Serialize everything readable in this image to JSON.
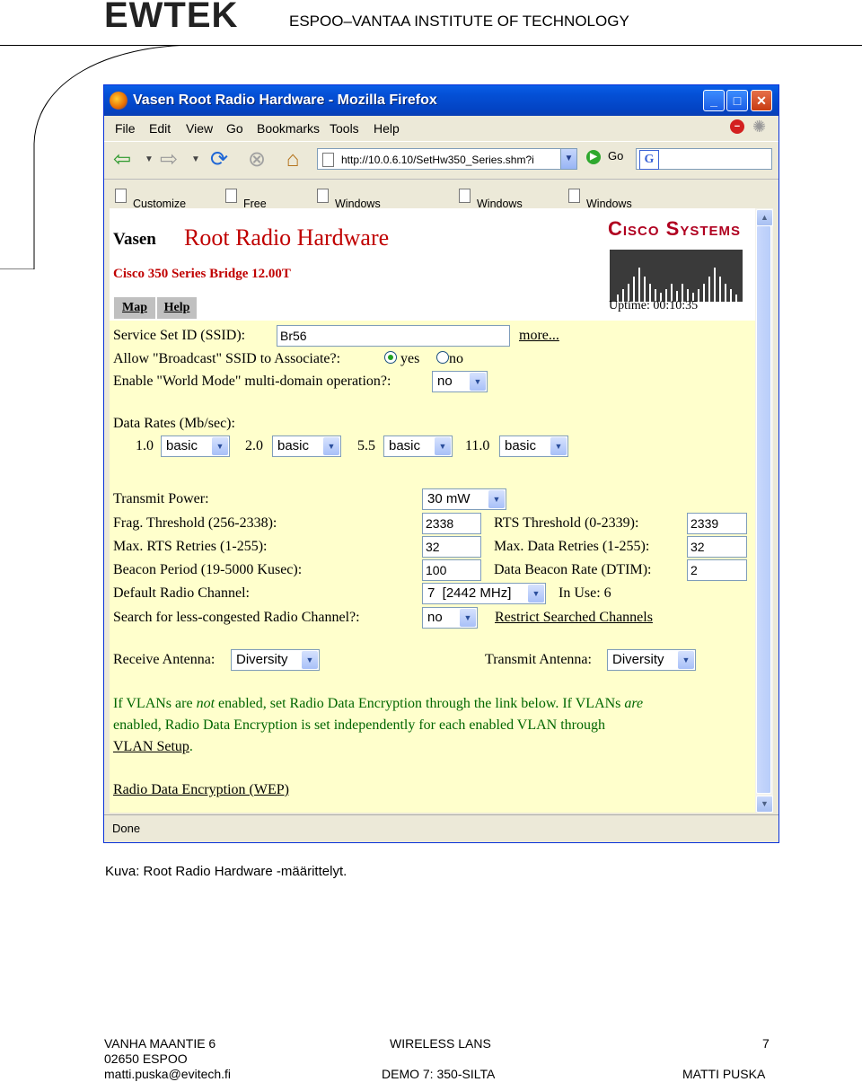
{
  "header": {
    "logo": "EWTEK",
    "institute": "ESPOO–VANTAA INSTITUTE OF TECHNOLOGY"
  },
  "browser": {
    "title": "Vasen Root Radio Hardware - Mozilla Firefox",
    "menu": [
      "File",
      "Edit",
      "View",
      "Go",
      "Bookmarks",
      "Tools",
      "Help"
    ],
    "url": "http://10.0.6.10/SetHw350_Series.shm?i",
    "go_label": "Go",
    "links": [
      "Customize Links",
      "Free Hotmail",
      "Windows Marketplace",
      "Windows Media",
      "Windows"
    ],
    "status": "Done"
  },
  "page": {
    "device": "Vasen",
    "title": "Root Radio Hardware",
    "bridge": "Cisco 350 Series Bridge 12.00T",
    "tabs": [
      "Map",
      "Help"
    ],
    "cisco_logo": "Cisco Systems",
    "uptime": "Uptime: 00:10:35",
    "ssid_label": "Service Set ID (SSID):",
    "ssid_value": "Br56",
    "more_link": "more...",
    "broadcast_label": "Allow \"Broadcast\" SSID to Associate?:",
    "broadcast_yes": "yes",
    "broadcast_no": "no",
    "broadcast_selected": "yes",
    "world_label": "Enable \"World Mode\" multi-domain operation?:",
    "world_value": "no",
    "rates_label": "Data Rates  (Mb/sec):",
    "rates": [
      {
        "rate": "1.0",
        "value": "basic"
      },
      {
        "rate": "2.0",
        "value": "basic"
      },
      {
        "rate": "5.5",
        "value": "basic"
      },
      {
        "rate": "11.0",
        "value": "basic"
      }
    ],
    "tx_power_label": "Transmit Power:",
    "tx_power_value": "30 mW",
    "frag_label": "Frag. Threshold (256-2338):",
    "frag_value": "2338",
    "rts_label": "RTS Threshold (0-2339):",
    "rts_value": "2339",
    "max_rts_label": "Max. RTS Retries (1-255):",
    "max_rts_value": "32",
    "max_data_label": "Max. Data Retries (1-255):",
    "max_data_value": "32",
    "beacon_label": "Beacon Period (19-5000 Kusec):",
    "beacon_value": "100",
    "dtim_label": "Data Beacon Rate (DTIM):",
    "dtim_value": "2",
    "channel_label": "Default Radio Channel:",
    "channel_value": "7  [2442 MHz]",
    "in_use": "In Use: 6",
    "search_label": "Search for less-congested Radio Channel?:",
    "search_value": "no",
    "restrict_link": "Restrict Searched Channels",
    "rx_antenna_label": "Receive Antenna:",
    "rx_antenna_value": "Diversity",
    "tx_antenna_label": "Transmit Antenna:",
    "tx_antenna_value": "Diversity",
    "vlan_text_1": "If VLANs are ",
    "vlan_text_not": "not",
    "vlan_text_2": " enabled, set Radio Data Encryption through the link below. If VLANs ",
    "vlan_text_are": "are",
    "vlan_text_3": "enabled, Radio Data Encryption is set independently for each enabled VLAN through ",
    "vlan_link": "VLAN Setup",
    "wep_link": "Radio Data Encryption (WEP)"
  },
  "caption": "Kuva: Root Radio Hardware -määrittelyt.",
  "footer": {
    "address_1": "VANHA MAANTIE 6",
    "address_2": "02650 ESPOO",
    "email": "matti.puska@evitech.fi",
    "center_1": "WIRELESS LANS",
    "center_2": "DEMO 7: 350-SILTA",
    "page_number": "7",
    "author": "MATTI PUSKA"
  }
}
